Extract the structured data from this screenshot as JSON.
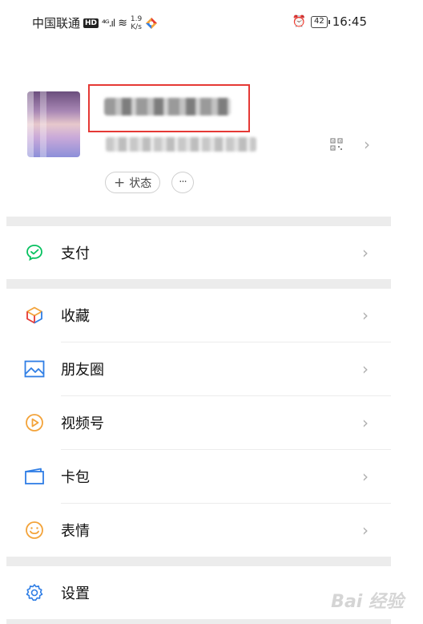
{
  "status_bar": {
    "carrier": "中国联通",
    "hd_badge": "HD",
    "signal": "⁴ᴳ.ıl",
    "wifi": "≋",
    "speed_value": "1.9",
    "speed_unit": "K/s",
    "alarm": "⏰",
    "battery": "42",
    "time": "16:45"
  },
  "profile": {
    "status_button_plus": "+",
    "status_button_label": "状态",
    "more_button_label": "···",
    "chevron": "›"
  },
  "menu": {
    "pay": {
      "label": "支付",
      "icon": "wechat-pay-icon",
      "color": "#07c160"
    },
    "favorites": {
      "label": "收藏",
      "icon": "cube-icon"
    },
    "moments": {
      "label": "朋友圈",
      "icon": "image-icon",
      "color": "#2f7ee5"
    },
    "channels": {
      "label": "视频号",
      "icon": "play-circle-icon",
      "color": "#f3a33a"
    },
    "cards": {
      "label": "卡包",
      "icon": "wallet-icon",
      "color": "#2f7ee5"
    },
    "stickers": {
      "label": "表情",
      "icon": "smiley-icon",
      "color": "#f3a33a"
    },
    "settings": {
      "label": "设置",
      "icon": "gear-icon",
      "color": "#2f7ee5"
    },
    "chevron": "›"
  },
  "watermark": "Bai 经验"
}
